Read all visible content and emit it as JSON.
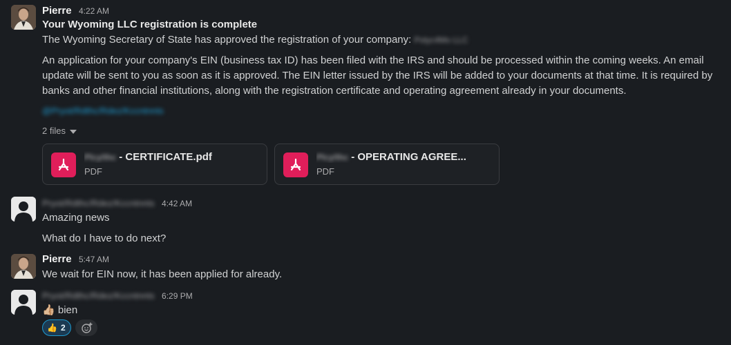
{
  "messages": [
    {
      "author": "Pierre",
      "time": "4:22 AM",
      "title": "Your Wyoming LLC registration is complete",
      "line1": "The Wyoming Secretary of State has approved the registration of your company:",
      "company_blur": "Polyc4Mo LLC",
      "paragraph": "An application for your company's EIN (business tax ID) has been filed with the IRS and should be processed within the coming weeks. An email update will be sent to you as soon as it is approved. The EIN letter issued by the IRS will be added to your documents at that time. It is required by banks and other financial institutions, along with the registration certificate and operating agreement already in your documents.",
      "link_blur": "@Pryot/Rdthc/Rdez/Kccntnnts",
      "files_label": "2 files",
      "files": [
        {
          "name_blur": "Plcy/thc",
          "name": " - CERTIFICATE.pdf",
          "type": "PDF"
        },
        {
          "name_blur": "Plcy/thc",
          "name": " - OPERATING AGREE...",
          "type": "PDF"
        }
      ]
    },
    {
      "author_blur": "Pryot/Rdthc/Rdez/Kccntnnts",
      "time": "4:42 AM",
      "line1": "Amazing news",
      "line2": "What do I have to do next?"
    },
    {
      "author": "Pierre",
      "time": "5:47 AM",
      "line1": "We wait for EIN now, it has been applied for already."
    },
    {
      "author_blur": "Pryot/Rdthc/Rdez/Kccntnnts",
      "time": "6:29 PM",
      "emoji": "👍🏼",
      "line1": "bien",
      "reaction_emoji": "👍",
      "reaction_count": "2"
    }
  ],
  "colors": {
    "background": "#1a1d21",
    "pdf_accent": "#e01e5a",
    "link": "#1d9bd1"
  }
}
